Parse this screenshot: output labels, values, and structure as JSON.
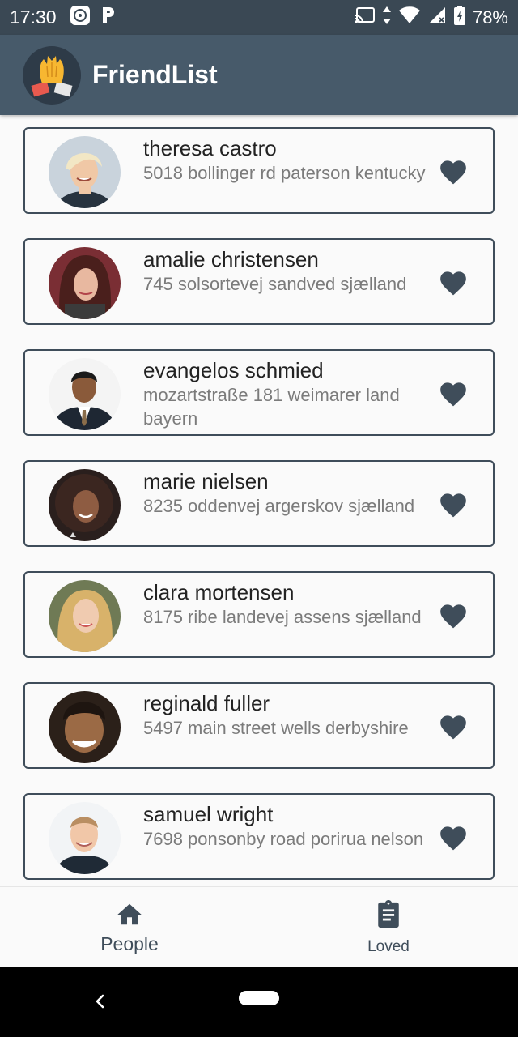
{
  "status_bar": {
    "time": "17:30",
    "battery": "78%",
    "icons": [
      "gallery-icon",
      "parking-icon",
      "cast-icon",
      "data-arrows-icon",
      "wifi-icon",
      "signal-icon",
      "battery-icon"
    ]
  },
  "app_bar": {
    "title": "FriendList",
    "logo_icon": "high-five-hands-icon"
  },
  "friends": [
    {
      "name": "theresa castro",
      "address": "5018 bollinger rd paterson kentucky"
    },
    {
      "name": "amalie christensen",
      "address": "745 solsortevej sandved sjælland"
    },
    {
      "name": "evangelos schmied",
      "address": "mozartstraße 181 weimarer land bayern"
    },
    {
      "name": "marie nielsen",
      "address": "8235 oddenvej argerskov sjælland"
    },
    {
      "name": "clara mortensen",
      "address": "8175 ribe landevej assens sjælland"
    },
    {
      "name": "reginald fuller",
      "address": "5497 main street wells derbyshire"
    },
    {
      "name": "samuel wright",
      "address": "7698 ponsonby road porirua nelson"
    }
  ],
  "bottom_nav": {
    "people": {
      "label": "People",
      "icon": "home-icon"
    },
    "loved": {
      "label": "Loved",
      "icon": "clipboard-icon"
    }
  },
  "colors": {
    "status_bar": "#3a4854",
    "app_bar": "#475a6a",
    "accent": "#3f4d5a",
    "background": "#fafafa"
  }
}
